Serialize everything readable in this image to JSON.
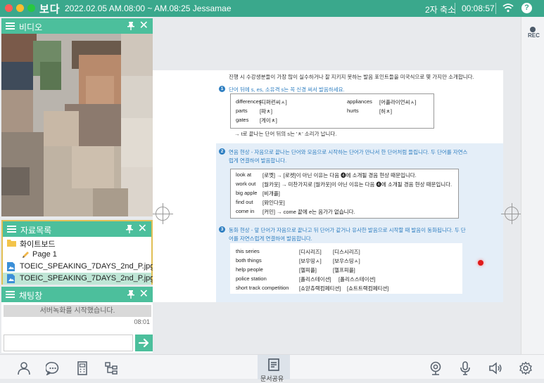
{
  "window": {
    "logo": "보다",
    "session": "2022.02.05 AM.08:00 ~ AM.08:25 Jessamae",
    "zoom_label": "2자 축소",
    "timer": "00:08:57",
    "help": "?"
  },
  "video_panel": {
    "title": "비디오"
  },
  "files_panel": {
    "title": "자료목록",
    "items": [
      {
        "label": "화이트보드"
      },
      {
        "label": "Page 1"
      },
      {
        "label": "TOEIC_SPEAKING_7DAYS_2nd_P.jpg"
      },
      {
        "label": "TOEIC_SPEAKING_7DAYS_2nd_P.jpg"
      }
    ]
  },
  "chat_panel": {
    "title": "채팅창",
    "system_message": "서버녹화를 시작했습니다.",
    "time": "08:01",
    "input_value": ""
  },
  "document": {
    "intro": "진행 시 수강생분들이 가장 많이 실수하거나 잘 지키지 못하는 발음 포인트들을 미국식으로 몇 가지만 소개합니다.",
    "section1": {
      "num": "1",
      "title": "단어 뒤에 s, es, 소유격 s는 꼭 신경 써서 발음하세요.",
      "examples_left": [
        {
          "word": "differences",
          "pron": "[디퍼런씨ㅅ]"
        },
        {
          "word": "parts",
          "pron": "[파ㅊ]"
        },
        {
          "word": "gates",
          "pron": "[게이ㅊ]"
        }
      ],
      "examples_right": [
        {
          "word": "appliances",
          "pron": "[어플라이언씨ㅅ]"
        },
        {
          "word": "hurts",
          "pron": "[허ㅊ]"
        }
      ],
      "note": "→ t로 끝나는 단어 뒤의 s는 'ㅊ' 소리가 납니다."
    },
    "section2": {
      "num": "2",
      "title_line1": "연음 현상 - 자음으로 끝나는 단어와 모음으로 시작하는 단어가 만나서 한 단어처럼 들립니다. 두 단어를 자연스",
      "title_line2": "럽게 연결하여 발음합니다.",
      "examples": [
        {
          "word": "look at",
          "pron": "[로껫] → [로켓]이 아닌 이유는 다음 ❹에 소개될 경음 현상 때문입니다."
        },
        {
          "word": "work out",
          "pron": "[월카웃] → 미찬가지로 [월카웃]이 아닌 이유는 다음 ❹에 소개될 경음 현상 때문입니다."
        },
        {
          "word": "big apple",
          "pron": "[비개플]"
        },
        {
          "word": "find out",
          "pron": "[퐈인다웃]"
        },
        {
          "word": "come in",
          "pron": "[커민] → come 끝에 e는 음가가 없습니다."
        }
      ]
    },
    "section3": {
      "num": "3",
      "title_line1": "동화 현상 - 앞 단어가 자음으로 끝나고 뒤 단어가 같거나 유사한 발음으로 시작할 때 발음이 동화됩니다. 두 단",
      "title_line2": "어를 자연스럽게 연결하여 발음합니다.",
      "examples": [
        {
          "word": "this series",
          "pron": "[디시리즈]",
          "alt": "[디스시리즈]"
        },
        {
          "word": "both things",
          "pron": "[보우띵ㅅ]",
          "alt": "[보우스띵ㅅ]"
        },
        {
          "word": "help people",
          "pron": "[헬피플]",
          "alt": "[헬프피플]"
        },
        {
          "word": "police station",
          "pron": "[폴리스테이션]",
          "alt": "[폴리스스테이션]"
        },
        {
          "word": "short track competition",
          "pron": "[쇼앋츄랙컴페티션]",
          "alt": "[쇼트트랙컴페티션]"
        }
      ]
    }
  },
  "right_strip": {
    "rec_label": "REC"
  },
  "bottom_bar": {
    "doc_share_label": "문서공유",
    "icons": [
      "person-icon",
      "chat-bubble-icon",
      "calculator-doc-icon",
      "hierarchy-icon",
      "camera-icon",
      "microphone-icon",
      "speaker-icon",
      "settings-icon"
    ]
  },
  "colors": {
    "brand_green": "#3aa88c",
    "panel_header": "#4cbf9c",
    "accent_blue": "#2f7fc1",
    "laser_red": "#e01b1b"
  }
}
